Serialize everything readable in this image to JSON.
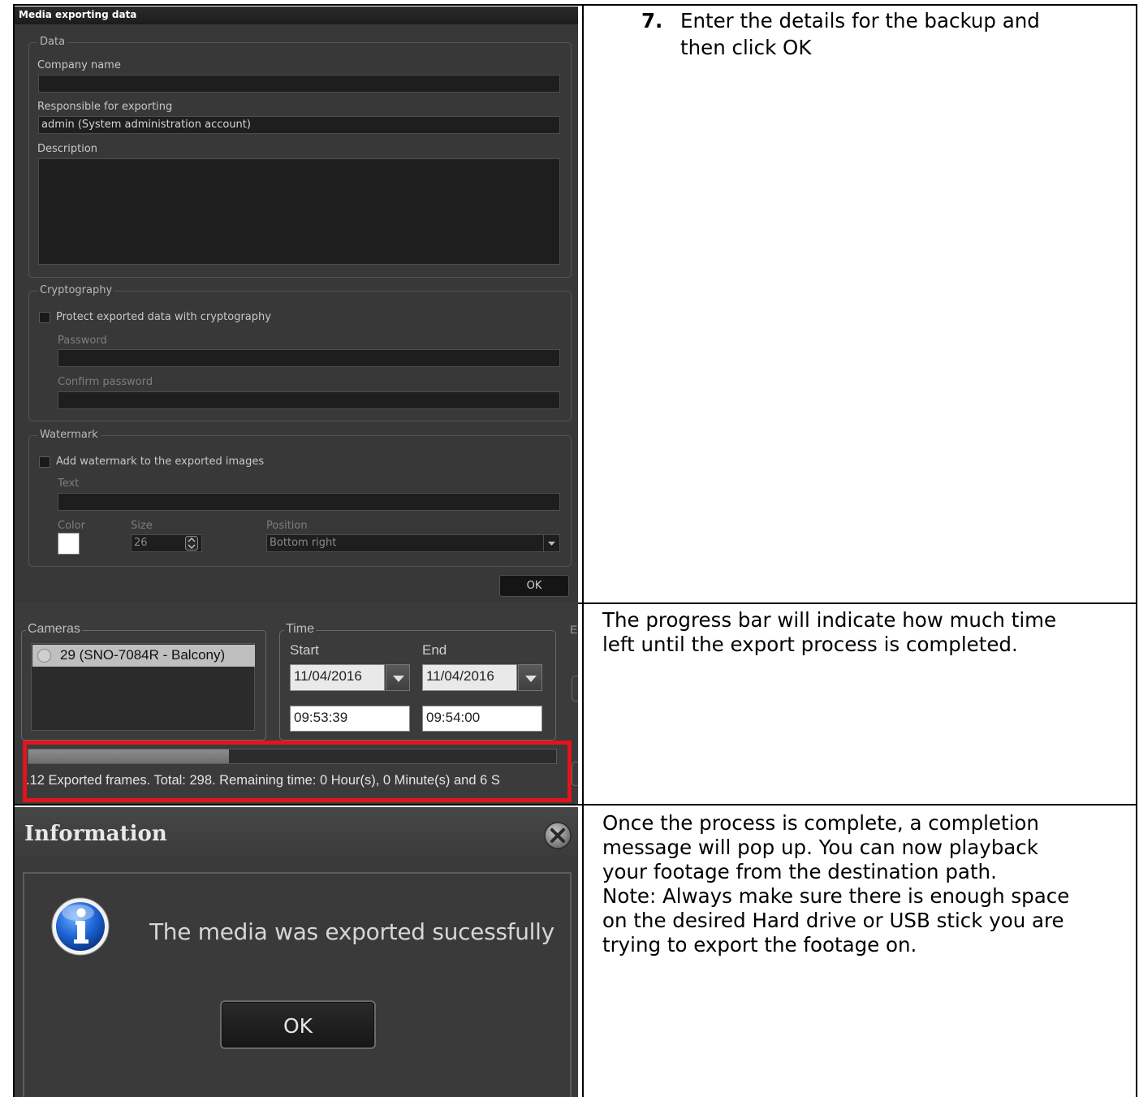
{
  "step": {
    "number": "7.",
    "instruction_line1": "Enter the details for the backup and",
    "instruction_line2": "then click OK"
  },
  "export_dialog": {
    "title": "Media exporting data",
    "data_group": {
      "legend": "Data",
      "company_name_label": "Company name",
      "company_name_value": "",
      "responsible_label": "Responsible for exporting",
      "responsible_value": "admin (System administration account)",
      "description_label": "Description",
      "description_value": ""
    },
    "cryptography_group": {
      "legend": "Cryptography",
      "protect_checkbox_label": "Protect exported data with cryptography",
      "protect_checked": false,
      "password_label": "Password",
      "confirm_password_label": "Confirm password"
    },
    "watermark_group": {
      "legend": "Watermark",
      "add_watermark_label": "Add watermark to the exported images",
      "add_watermark_checked": false,
      "text_label": "Text",
      "color_label": "Color",
      "color_value": "#ffffff",
      "size_label": "Size",
      "size_value": "26",
      "position_label": "Position",
      "position_value": "Bottom right"
    },
    "ok_label": "OK"
  },
  "progress_panel": {
    "cameras_legend": "Cameras",
    "camera_item": "29 (SNO-7084R - Balcony)",
    "time_legend": "Time",
    "start_label": "Start",
    "end_label": "End",
    "start_date": "11/04/2016",
    "end_date": "11/04/2016",
    "start_time": "09:53:39",
    "end_time": "09:54:00",
    "partial_legend": "E",
    "progress_fraction": 0.38,
    "status_text": ".12 Exported frames. Total: 298. Remaining time: 0 Hour(s), 0 Minute(s) and 6 S",
    "highlight_color": "#e3141c"
  },
  "progress_description": {
    "line1": "The progress bar will indicate how much time",
    "line2": "left until the export process is completed."
  },
  "info_dialog": {
    "title": "Information",
    "message": "The media was exported sucessfully",
    "ok_label": "OK",
    "icon": "info-icon"
  },
  "completion_description": {
    "line1": "Once the process is complete, a completion",
    "line2": "message will pop up. You can now playback",
    "line3": "your footage from the destination path.",
    "line4": "Note: Always make sure there is enough space",
    "line5": "on the desired Hard drive or USB stick you are",
    "line6": "trying to export the footage on."
  }
}
